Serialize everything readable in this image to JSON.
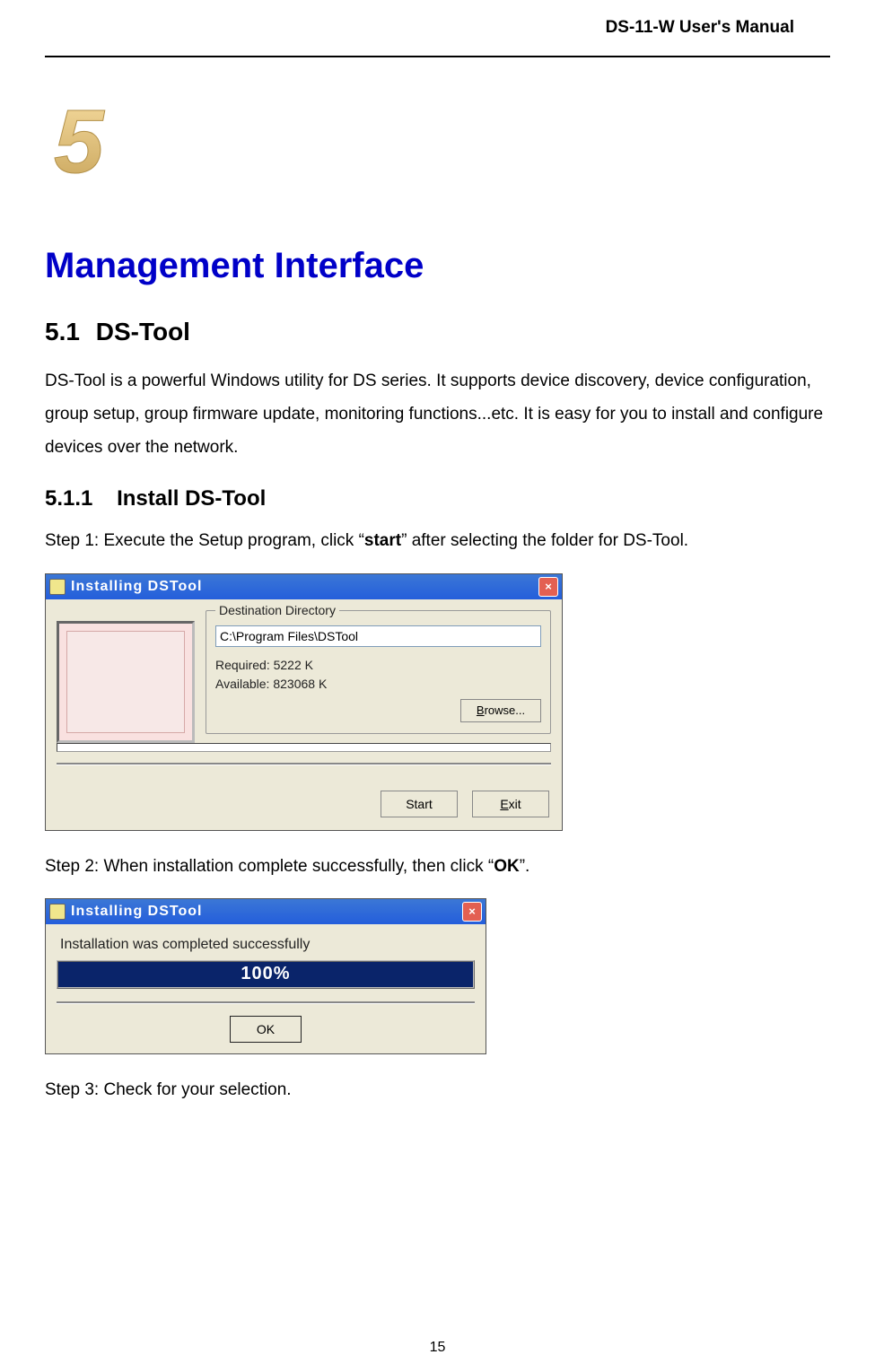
{
  "header": {
    "title": "DS-11-W User's Manual"
  },
  "chapter": {
    "number_glyph": "5",
    "title": "Management Interface"
  },
  "section": {
    "number": "5.1",
    "title": "DS-Tool"
  },
  "intro_paragraph": "DS-Tool is a powerful Windows utility for DS series.    It supports device discovery, device configuration, group setup, group firmware update, monitoring functions...etc.    It is easy for you to install and configure devices over the network.",
  "subsection": {
    "number": "5.1.1",
    "title": "Install DS-Tool"
  },
  "step1": {
    "prefix": "Step 1: Execute the Setup program, click “",
    "bold": "start",
    "suffix": "” after selecting the folder for DS-Tool."
  },
  "figure1": {
    "window_title": "Installing DSTool",
    "group_label": "Destination Directory",
    "path_value": "C:\\Program Files\\DSTool",
    "required_label": "Required: 5222 K",
    "available_label": "Available: 823068 K",
    "browse_first": "B",
    "browse_rest": "rowse...",
    "start_label": "Start",
    "exit_first": "E",
    "exit_rest": "xit"
  },
  "step2": {
    "prefix": "Step 2: When installation complete successfully, then click “",
    "bold": "OK",
    "suffix": "”."
  },
  "figure2": {
    "window_title": "Installing DSTool",
    "message": "Installation was completed successfully",
    "progress_text": "100%",
    "ok_label": "OK"
  },
  "step3": {
    "text": "Step 3: Check for your selection."
  },
  "page_number": "15"
}
